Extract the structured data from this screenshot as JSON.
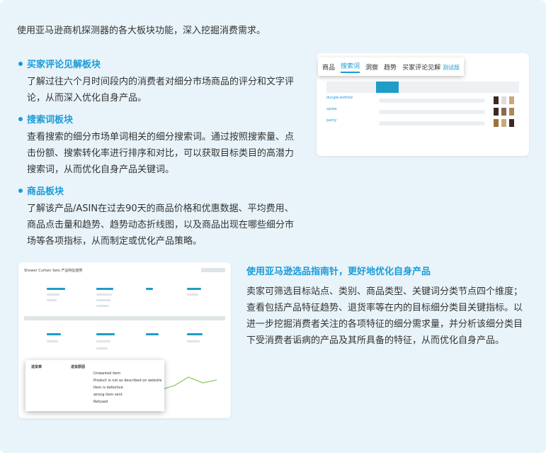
{
  "intro": "使用亚马逊商机探测器的各大板块功能，深入挖掘消费需求。",
  "sections": [
    {
      "title": "买家评论见解板块",
      "text": "了解过往六个月时间段内的消费者对细分市场商品的评分和文字评论，从而深入优化自身产品。"
    },
    {
      "title": "搜索词板块",
      "text": "查看搜索的细分市场单词相关的细分搜索词。通过按照搜索量、点击份额、搜索转化率进行排序和对比，可以获取目标类目的高潜力搜索词，从而优化自身产品关键词。"
    },
    {
      "title": "商品板块",
      "text": "了解该产品/ASIN在过去90天的商品价格和优惠数据、平均费用、商品点击量和趋势、趋势动态折线图，以及商品出现在哪些细分市场等各项指标，从而制定或优化产品策略。"
    }
  ],
  "screenshot1": {
    "tabs": [
      "商品",
      "搜索词",
      "洞察",
      "趋势",
      "买家评论见解"
    ],
    "trial": "测试版",
    "rows": [
      "dungle-bottled",
      "spoke",
      "panty"
    ]
  },
  "screenshot2": {
    "title": "Shower Curtain Sets  产品特征趋势",
    "popup_left": "退货率",
    "popup_right": "退货原因",
    "reasons": [
      "Unwanted item",
      "Product is not as described on website",
      "Item is defective",
      "wrong item sent",
      "Refused"
    ]
  },
  "right": {
    "title": "使用亚马逊选品指南针，更好地优化自身产品",
    "text": "卖家可筛选目标站点、类别、商品类型、关键词分类节点四个维度；查看包括产品特征趋势、退货率等在内的目标细分类目关键指标。以进一步挖掘消费者关注的各项特征的细分需求量，并分析该细分类目下受消费者诟病的产品及其所具备的特征，从而优化自身产品。"
  }
}
